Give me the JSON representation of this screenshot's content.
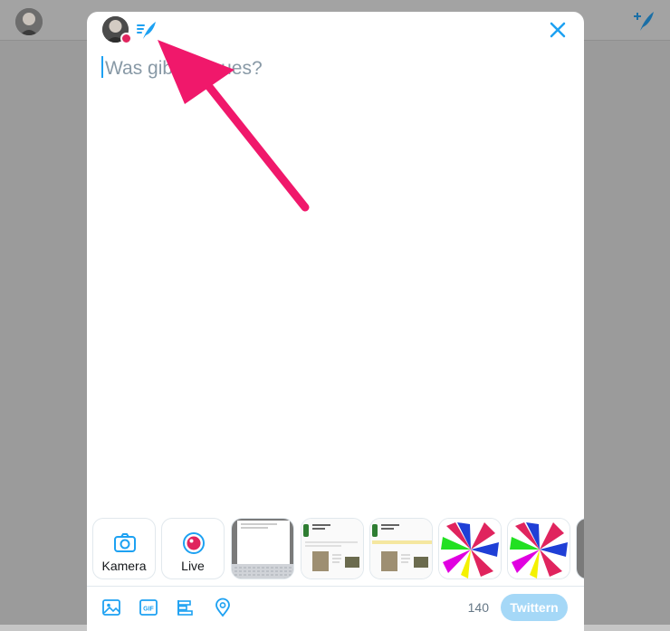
{
  "background": {
    "header_avatar_icon": "user-avatar",
    "compose_icon": "compose-tweet-icon"
  },
  "modal": {
    "avatar_icon": "user-avatar",
    "thread_icon": "thread-icon",
    "close_icon": "close-icon",
    "compose_placeholder": "Was gibt's Neues?",
    "media_tiles": [
      {
        "label": "Kamera",
        "icon": "camera-icon"
      },
      {
        "label": "Live",
        "icon": "live-icon"
      },
      {
        "label": "",
        "icon": "photo-thumbnail"
      },
      {
        "label": "",
        "icon": "photo-thumbnail"
      },
      {
        "label": "",
        "icon": "photo-thumbnail"
      },
      {
        "label": "",
        "icon": "photo-thumbnail"
      },
      {
        "label": "",
        "icon": "photo-thumbnail"
      }
    ],
    "toolbar": {
      "image_icon": "image-icon",
      "gif_label": "GIF",
      "poll_icon": "poll-icon",
      "location_icon": "location-icon",
      "char_count": "140",
      "tweet_label": "Twittern"
    }
  },
  "annotation": {
    "arrow_color": "#f0186b"
  },
  "colors": {
    "accent": "#1da1f2",
    "tweet_button_disabled": "#a5d8f7",
    "live_red": "#e0245e"
  }
}
